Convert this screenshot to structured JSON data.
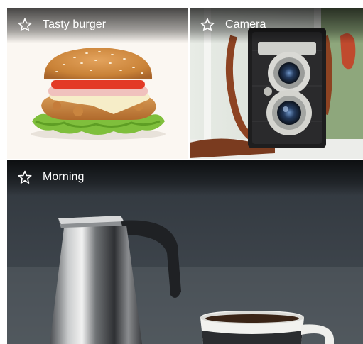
{
  "grid": {
    "tiles": [
      {
        "title": "Tasty burger",
        "icon": "star-outline-icon"
      },
      {
        "title": "Camera",
        "icon": "star-outline-icon"
      },
      {
        "title": "Morning",
        "icon": "star-outline-icon"
      }
    ]
  },
  "colors": {
    "title_text": "#ffffff",
    "divider": "#ffffff"
  }
}
